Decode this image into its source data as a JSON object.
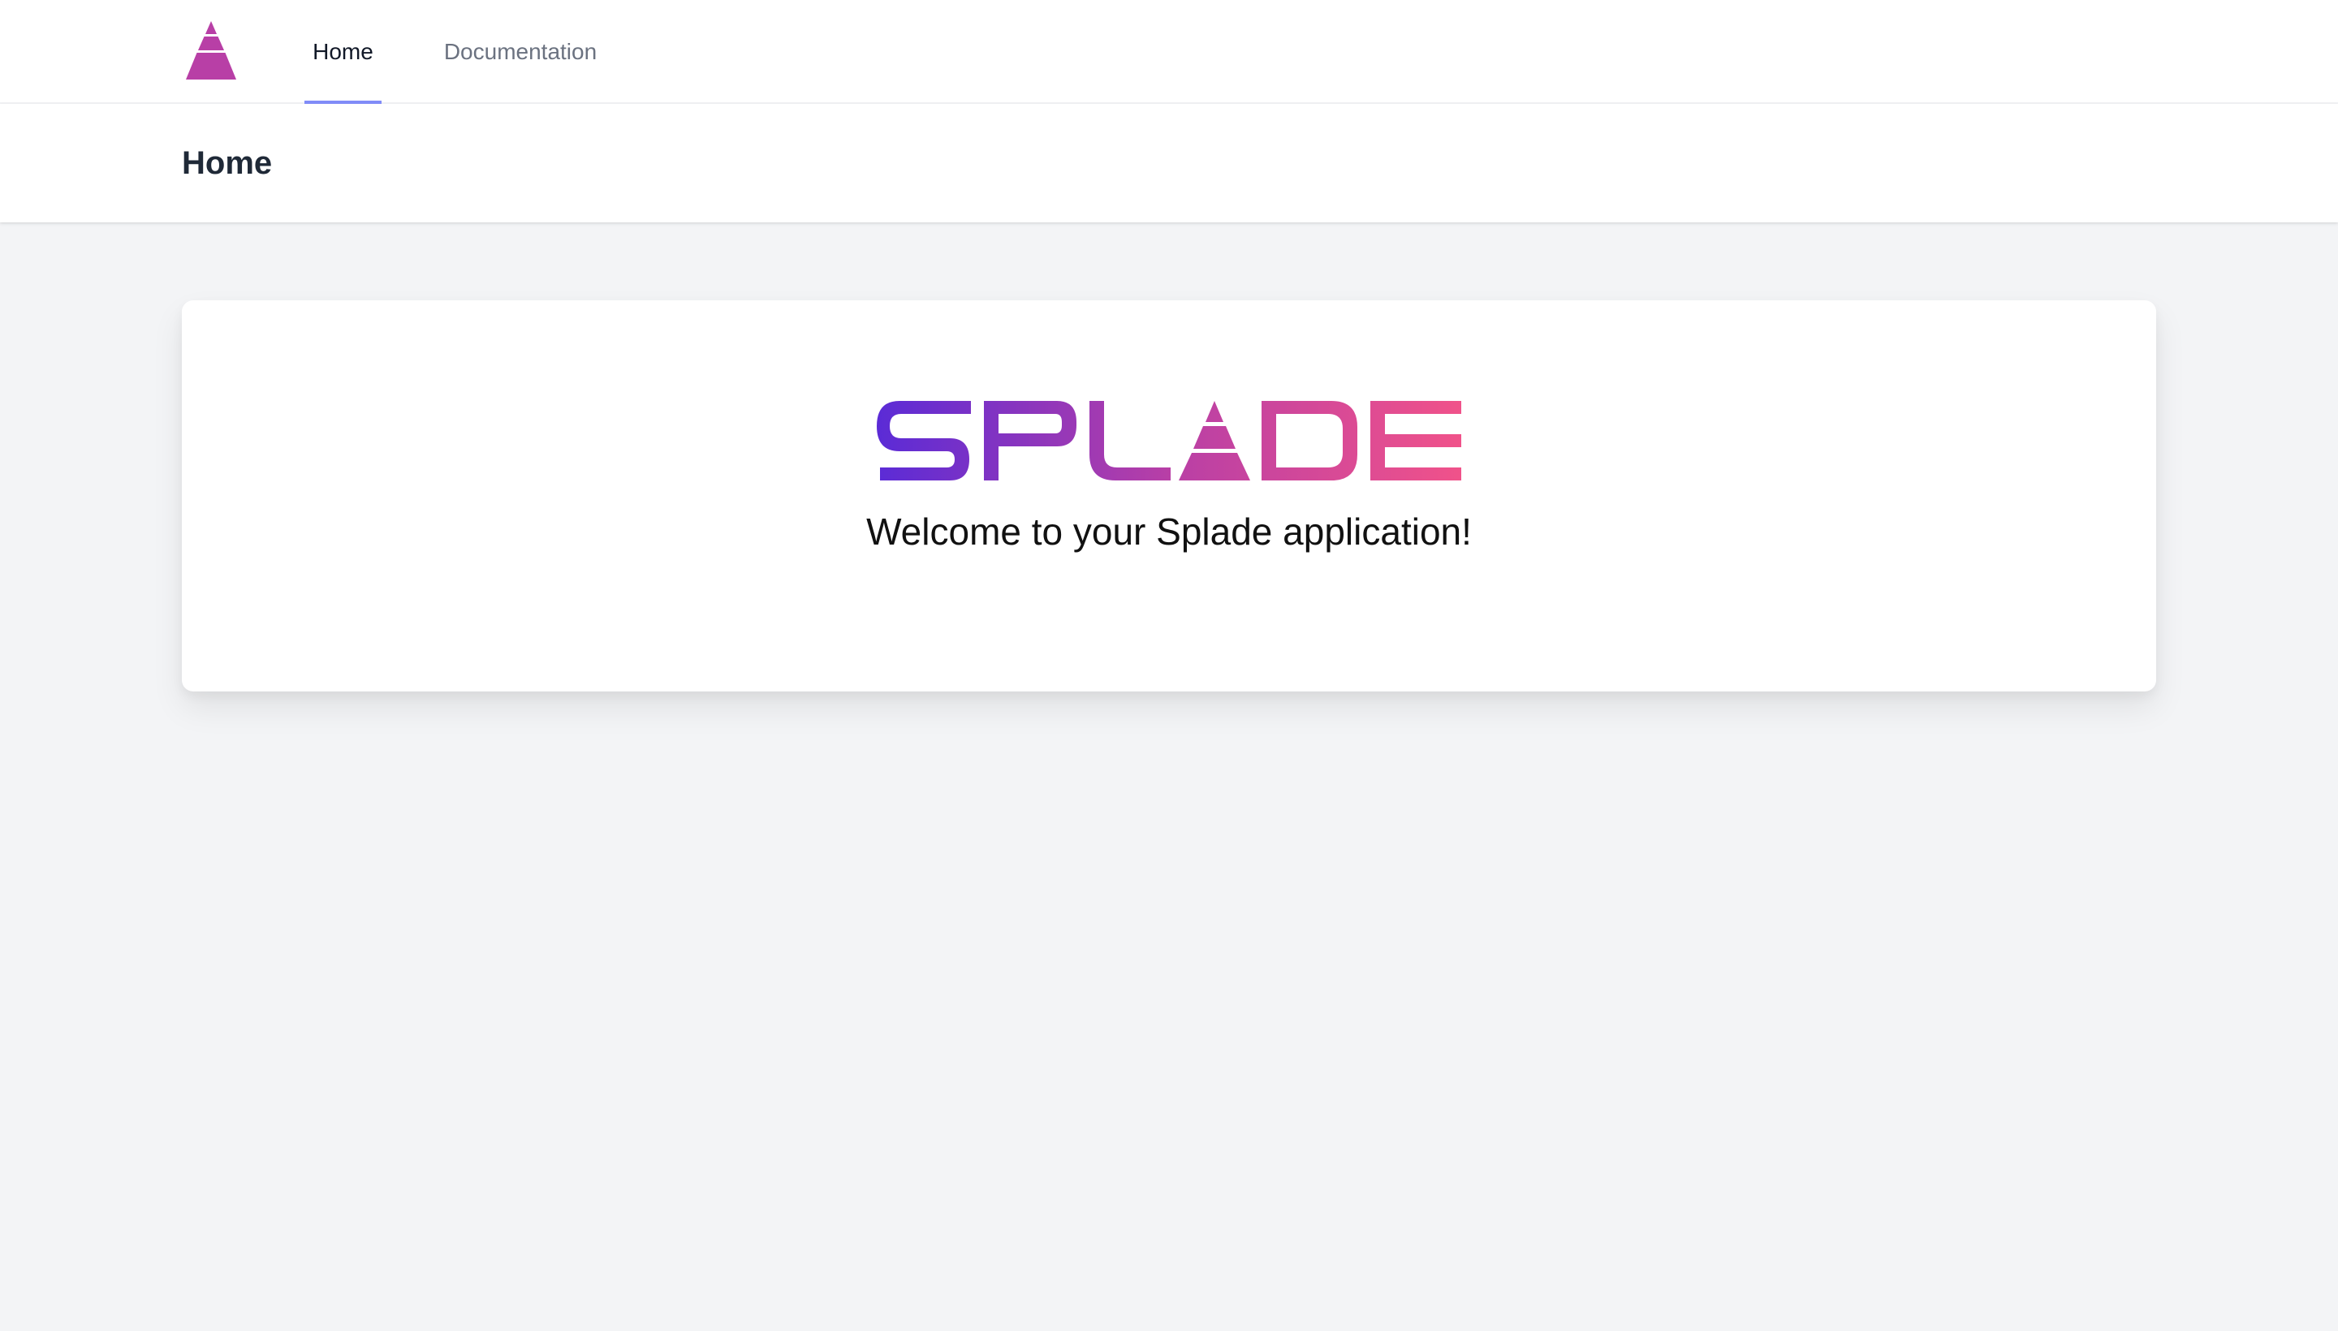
{
  "nav": {
    "logo_icon": "splade-pyramid-icon",
    "links": [
      {
        "label": "Home",
        "active": true
      },
      {
        "label": "Documentation",
        "active": false
      }
    ]
  },
  "header": {
    "title": "Home"
  },
  "card": {
    "logo_text": "SPLADE",
    "welcome_text": "Welcome to your Splade application!"
  },
  "colors": {
    "background": "#f3f4f6",
    "surface": "#ffffff",
    "active_underline": "#818cf8",
    "brand_purple": "#5b2bd6",
    "brand_magenta": "#b83fa6",
    "brand_pink": "#f0528a"
  }
}
